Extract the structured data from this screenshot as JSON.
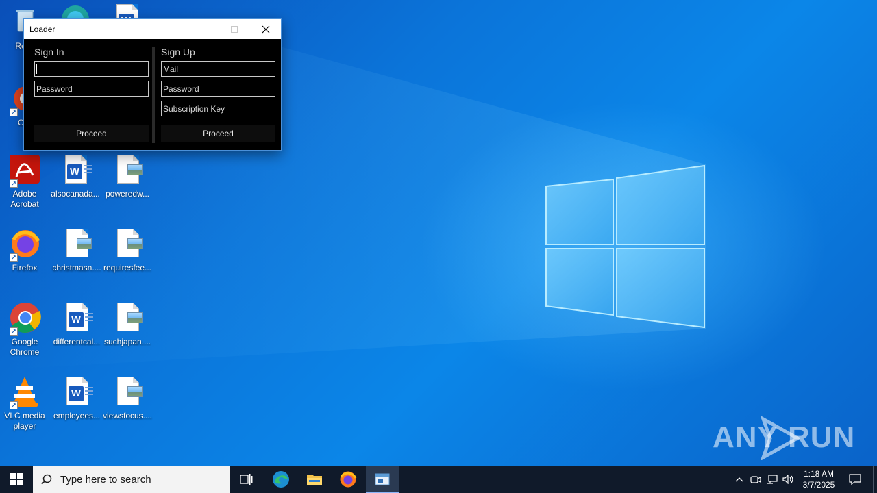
{
  "desktop": {
    "icons": [
      {
        "label": "Recy"
      },
      {
        "label": "CCl"
      },
      {
        "label": "Adobe Acrobat"
      },
      {
        "label": "alsocanada..."
      },
      {
        "label": "poweredw..."
      },
      {
        "label": "Firefox"
      },
      {
        "label": "christmasn...."
      },
      {
        "label": "requiresfee..."
      },
      {
        "label": "Google Chrome"
      },
      {
        "label": "differentcal..."
      },
      {
        "label": "suchjapan...."
      },
      {
        "label": "VLC media player"
      },
      {
        "label": "employees..."
      },
      {
        "label": "viewsfocus...."
      }
    ]
  },
  "loader": {
    "title": "Loader",
    "sign_in": {
      "heading": "Sign In",
      "username_value": "",
      "password_placeholder": "Password",
      "proceed_label": "Proceed"
    },
    "sign_up": {
      "heading": "Sign Up",
      "mail_placeholder": "Mail",
      "password_placeholder": "Password",
      "key_placeholder": "Subscription Key",
      "proceed_label": "Proceed"
    }
  },
  "taskbar": {
    "search_placeholder": "Type here to search",
    "time": "1:18 AM",
    "date": "3/7/2025",
    "apps": [
      "task-view",
      "edge",
      "file-explorer",
      "firefox",
      "loader"
    ]
  },
  "watermark": {
    "text_left": "ANY",
    "text_right": "RUN"
  },
  "colors": {
    "accent": "#0a6fd6",
    "taskbar": "#101a2a"
  }
}
